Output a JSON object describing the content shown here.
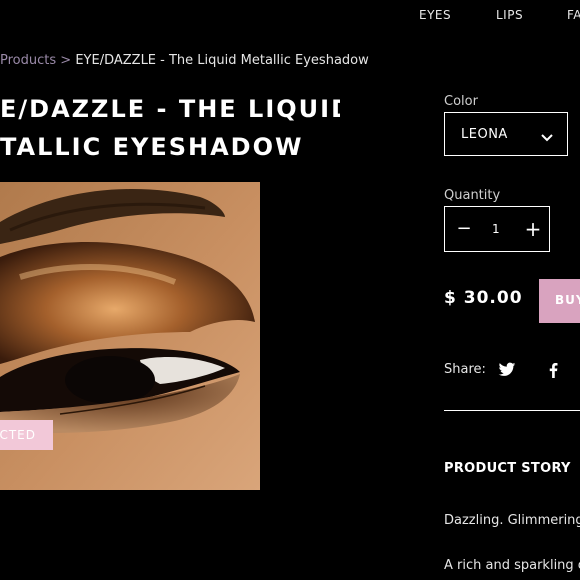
{
  "nav": {
    "items": [
      "EYES",
      "LIPS",
      "FA"
    ]
  },
  "breadcrumb": {
    "parent": "Products",
    "separator": ">",
    "current": "EYE/DAZZLE - The Liquid Metallic Eyeshadow"
  },
  "product": {
    "title_line1": "E/DAZZLE - THE LIQUID",
    "title_line2": "TALLIC EYESHADOW",
    "image_alt": "eye-closeup-bronze-eyeshadow",
    "badge": "CTED"
  },
  "options": {
    "color_label": "Color",
    "color_value": "LEONA",
    "quantity_label": "Quantity",
    "quantity_value": "1",
    "minus": "−",
    "plus": "+"
  },
  "purchase": {
    "price": "$ 30.00",
    "buy_label": "BUY"
  },
  "share": {
    "label": "Share:",
    "icons": [
      "twitter-icon",
      "facebook-icon"
    ]
  },
  "story": {
    "heading": "PRODUCT STORY",
    "paragraph1": "Dazzling. Glimmering.",
    "paragraph2": "A rich and sparkling co"
  },
  "colors": {
    "background": "#000000",
    "badge": "#f2c8d8",
    "buy_button": "#d9a3bf",
    "breadcrumb_muted": "#9a8aa8"
  }
}
